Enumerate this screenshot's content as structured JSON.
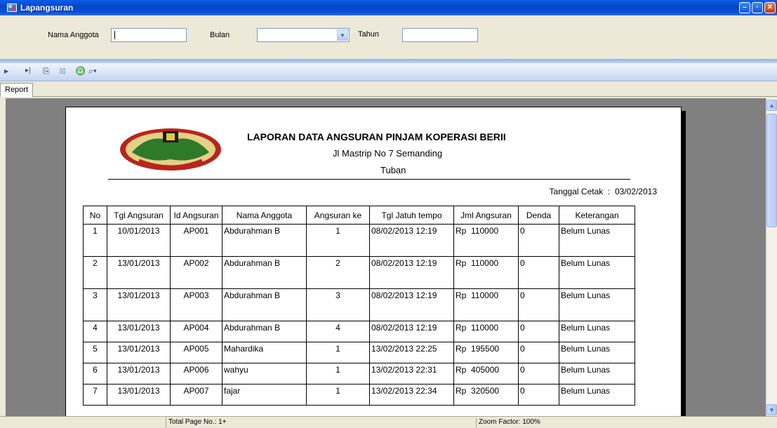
{
  "window": {
    "title": "Lapangsuran"
  },
  "filters": {
    "nama_anggota_label": "Nama Anggota",
    "nama_anggota_value": "",
    "bulan_label": "Bulan",
    "bulan_value": "",
    "tahun_label": "Tahun",
    "tahun_value": ""
  },
  "toolbar": {
    "export_icon": "export-icon",
    "print_icon": "print-icon",
    "search_icon": "binoculars-icon",
    "zoom_icon": "zoom-icon"
  },
  "tab": {
    "label": "Report"
  },
  "report": {
    "title": "LAPORAN DATA ANGSURAN PINJAM KOPERASI BERII",
    "address": "Jl Mastrip No 7 Semanding",
    "city": "Tuban",
    "print_date_label": "Tanggal Cetak",
    "print_date_sep": ":",
    "print_date": "03/02/2013",
    "columns": [
      "No",
      "Tgl Angsuran",
      "Id Angsuran",
      "Nama Anggota",
      "Angsuran ke",
      "Tgl Jatuh tempo",
      "Jml Angsuran",
      "Denda",
      "Keterangan"
    ],
    "rows": [
      {
        "no": "1",
        "tgl": "10/01/2013",
        "id": "AP001",
        "nama": "Abdurahman B",
        "ke": "1",
        "jatuh": "08/02/2013 12:19",
        "rp": "Rp",
        "jml": "110000",
        "denda": "0",
        "ket": "Belum Lunas"
      },
      {
        "no": "2",
        "tgl": "13/01/2013",
        "id": "AP002",
        "nama": "Abdurahman B",
        "ke": "2",
        "jatuh": "08/02/2013 12:19",
        "rp": "Rp",
        "jml": "110000",
        "denda": "0",
        "ket": "Belum Lunas"
      },
      {
        "no": "3",
        "tgl": "13/01/2013",
        "id": "AP003",
        "nama": "Abdurahman B",
        "ke": "3",
        "jatuh": "08/02/2013 12:19",
        "rp": "Rp",
        "jml": "110000",
        "denda": "0",
        "ket": "Belum Lunas"
      },
      {
        "no": "4",
        "tgl": "13/01/2013",
        "id": "AP004",
        "nama": "Abdurahman B",
        "ke": "4",
        "jatuh": "08/02/2013 12:19",
        "rp": "Rp",
        "jml": "110000",
        "denda": "0",
        "ket": "Belum Lunas"
      },
      {
        "no": "5",
        "tgl": "13/01/2013",
        "id": "AP005",
        "nama": "Mahardika",
        "ke": "1",
        "jatuh": "13/02/2013 22:25",
        "rp": "Rp",
        "jml": "195500",
        "denda": "0",
        "ket": "Belum Lunas"
      },
      {
        "no": "6",
        "tgl": "13/01/2013",
        "id": "AP006",
        "nama": "wahyu",
        "ke": "1",
        "jatuh": "13/02/2013 22:31",
        "rp": "Rp",
        "jml": "405000",
        "denda": "0",
        "ket": "Belum Lunas"
      },
      {
        "no": "7",
        "tgl": "13/01/2013",
        "id": "AP007",
        "nama": "fajar",
        "ke": "1",
        "jatuh": "13/02/2013 22:34",
        "rp": "Rp",
        "jml": "320500",
        "denda": "0",
        "ket": "Belum Lunas"
      }
    ]
  },
  "status": {
    "total_page": "Total Page No.: 1+",
    "zoom": "Zoom Factor: 100%"
  }
}
